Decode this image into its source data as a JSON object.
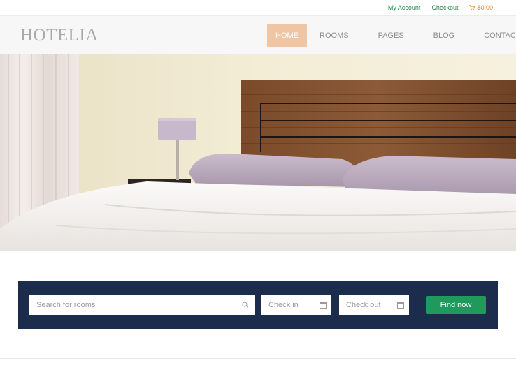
{
  "topbar": {
    "my_account": "My Account",
    "checkout": "Checkout",
    "cart_total": "$0.00",
    "cart_icon": "cart-icon"
  },
  "header": {
    "logo": "HOTELIA",
    "nav": [
      "HOME",
      "ROOMS",
      "PAGES",
      "BLOG",
      "CONTACTS"
    ],
    "active_nav": "HOME"
  },
  "hero": {
    "image": "bedroom-photo"
  },
  "booking": {
    "search_placeholder": "Search for rooms",
    "search_icon": "search-icon",
    "checkin_placeholder": "Check in",
    "checkout_placeholder": "Check out",
    "calendar_icon": "calendar-icon",
    "find_button": "Find now"
  },
  "colors": {
    "accent_green": "#1f9a5c",
    "nav_active": "#f0c5a3",
    "booking_bg": "#1c2c4c",
    "cart_orange": "#e08a2a"
  }
}
